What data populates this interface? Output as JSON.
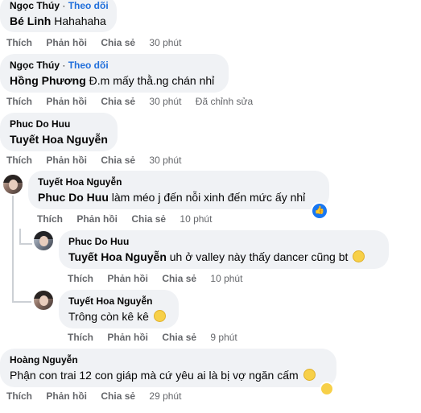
{
  "comments": [
    {
      "author": "Ngọc Thúy",
      "follow": "Theo dõi",
      "mention": "Bé Linh",
      "text": " Hahahaha",
      "like": "Thích",
      "reply": "Phản hồi",
      "share": "Chia sẻ",
      "time": "30 phút"
    },
    {
      "author": "Ngọc Thúy",
      "follow": "Theo dõi",
      "mention": "Hồng Phương",
      "text": " Đ.m mấy thằ.ng chán nhỉ",
      "like": "Thích",
      "reply": "Phản hồi",
      "share": "Chia sẻ",
      "time": "30 phút",
      "edited": "Đã chỉnh sửa"
    },
    {
      "author": "Phuc Do Huu",
      "mention": "Tuyết Hoa Nguyễn",
      "text": "",
      "like": "Thích",
      "reply": "Phản hồi",
      "share": "Chia sẻ",
      "time": "30 phút"
    },
    {
      "author": "Tuyết Hoa Nguyễn",
      "mention": "Phuc Do Huu",
      "text": " làm méo j đến nỗi xinh đến mức ấy nhỉ",
      "like": "Thích",
      "reply": "Phản hồi",
      "share": "Chia sẻ",
      "time": "10 phút"
    },
    {
      "author": "Phuc Do Huu",
      "mention": "Tuyết Hoa Nguyễn",
      "text": " uh ở valley này thấy dancer cũng bt",
      "like": "Thích",
      "reply": "Phản hồi",
      "share": "Chia sẻ",
      "time": "10 phút"
    },
    {
      "author": "Tuyết Hoa Nguyễn",
      "mention": "",
      "text": "Trông còn kê kê",
      "like": "Thích",
      "reply": "Phản hồi",
      "share": "Chia sẻ",
      "time": "9 phút"
    },
    {
      "author": "Hoàng Nguyễn",
      "mention": "",
      "text": "Phận con trai 12 con giáp mà cứ yêu ai là bị vợ ngăn cấm",
      "like": "Thích",
      "reply": "Phản hồi",
      "share": "Chia sẻ",
      "time": "29 phút"
    }
  ],
  "icons": {
    "like_reaction": "thumbs-up-icon",
    "smile_emoji": "smile-emoji-icon",
    "laugh_emoji": "laugh-emoji-icon",
    "tongue_emoji": "tongue-emoji-icon"
  },
  "colors": {
    "bubble": "#f0f2f5",
    "follow_link": "#216fdb",
    "meta_text": "#65676b",
    "like_badge": "#1877f2"
  }
}
